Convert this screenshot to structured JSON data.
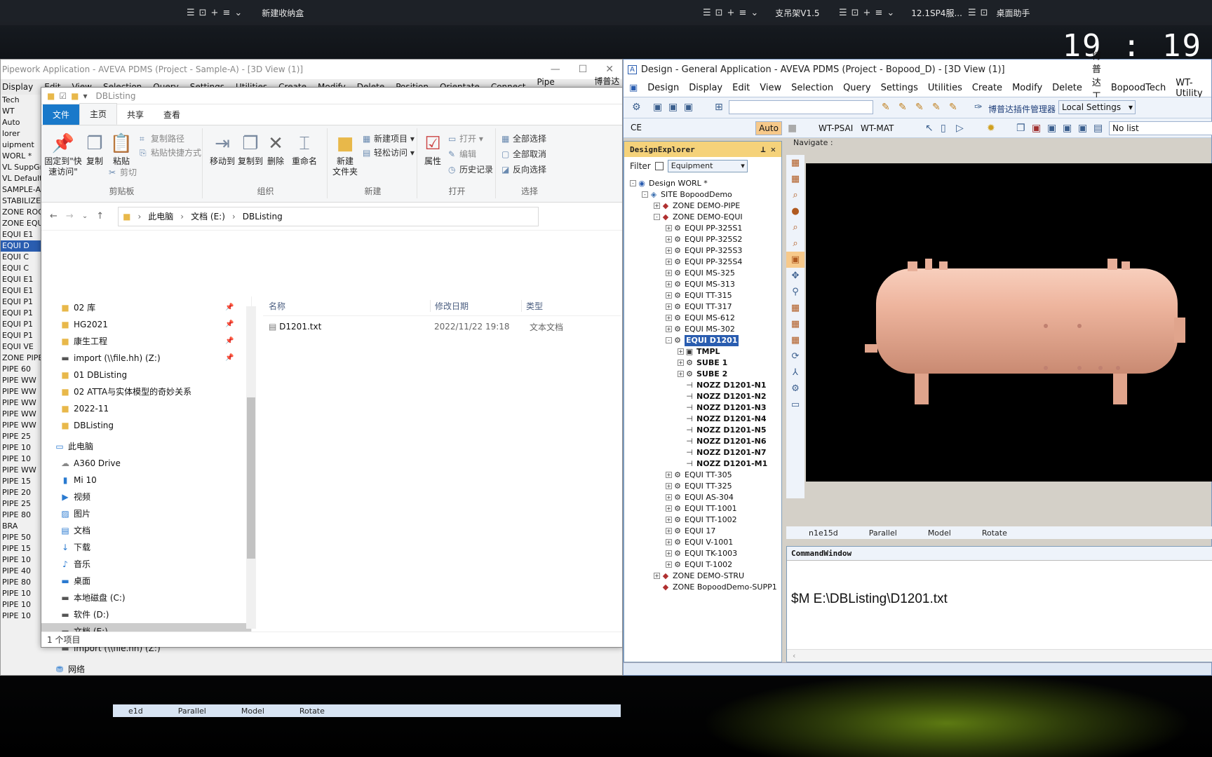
{
  "taskbar": {
    "groups": [
      {
        "label": "新建收纳盒"
      },
      {
        "label": "支吊架V1.5"
      },
      {
        "label": "12.1SP4服..."
      },
      {
        "label": "桌面助手"
      }
    ],
    "clock": "19 : 19"
  },
  "pipework": {
    "title": "Pipework Application -  AVEVA PDMS (Project - Sample-A) - [3D View (1)]",
    "menu": [
      "Display",
      "Edit",
      "View",
      "Selection",
      "Query",
      "Settings",
      "Utilities",
      "Create",
      "Modify",
      "Delete",
      "Position",
      "Orientate",
      "Connect",
      "Pipe Fabrication",
      "博普达工具集"
    ],
    "side_fragments": [
      "Tech",
      "WT",
      "Auto",
      "lorer",
      "uipment",
      "WORL *",
      "VL SuppGro",
      "VL Default_I",
      "SAMPLE-A",
      "STABILIZE",
      "ZONE ROO",
      "ZONE EQUI",
      "EQUI E1",
      "EQUI D",
      "EQUI C",
      "EQUI C",
      "EQUI E1",
      "EQUI E1",
      "EQUI P1",
      "EQUI P1",
      "EQUI P1",
      "EQUI P1",
      "EQUI VE",
      "ZONE PIPES",
      "PIPE 60",
      "PIPE WW",
      "PIPE WW",
      "PIPE WW",
      "PIPE WW",
      "PIPE WW",
      "PIPE 25",
      "PIPE 10",
      "PIPE 10",
      "PIPE WW",
      "PIPE 15",
      "PIPE 20",
      "PIPE 25",
      "PIPE 80",
      "BRA",
      "PIPE 50",
      "PIPE 15",
      "PIPE 10",
      "PIPE 40",
      "PIPE 80",
      "PIPE 10",
      "PIPE 10",
      "PIPE 10"
    ],
    "status": [
      "e1d",
      "Parallel",
      "Model",
      "Rotate"
    ]
  },
  "explorer": {
    "title": "DBListing",
    "tabs": [
      "文件",
      "主页",
      "共享",
      "查看"
    ],
    "ribbon": {
      "pin": "固定到\"快速访问\"",
      "copy": "复制",
      "paste": "粘贴",
      "copy_path": "复制路径",
      "paste_shortcut": "粘贴快捷方式",
      "cut": "剪切",
      "clipboard_group": "剪贴板",
      "move_to": "移动到",
      "copy_to": "复制到",
      "delete": "删除",
      "rename": "重命名",
      "organize_group": "组织",
      "new_folder": "新建\n文件夹",
      "new_item": "新建项目",
      "easy_access": "轻松访问",
      "new_group": "新建",
      "properties": "属性",
      "open": "打开",
      "edit": "编辑",
      "history": "历史记录",
      "open_group": "打开",
      "select_all": "全部选择",
      "select_none": "全部取消",
      "invert": "反向选择",
      "select_group": "选择"
    },
    "address": [
      "此电脑",
      "文档 (E:)",
      "DBListing"
    ],
    "nav": [
      {
        "label": "02 库",
        "icon": "folder",
        "pinned": true
      },
      {
        "label": "HG2021",
        "icon": "folder",
        "pinned": true
      },
      {
        "label": "康生工程",
        "icon": "folder",
        "pinned": true
      },
      {
        "label": "import (\\\\file.hh) (Z:)",
        "icon": "net",
        "pinned": true
      },
      {
        "label": "01 DBListing",
        "icon": "folder",
        "pinned": false
      },
      {
        "label": "02 ATTA与实体模型的奇妙关系",
        "icon": "folder",
        "pinned": false
      },
      {
        "label": "2022-11",
        "icon": "folder",
        "pinned": false
      },
      {
        "label": "DBListing",
        "icon": "folder",
        "pinned": false
      },
      {
        "label": "此电脑",
        "icon": "pc",
        "pinned": false,
        "top": true
      },
      {
        "label": "A360 Drive",
        "icon": "cloud",
        "pinned": false
      },
      {
        "label": "Mi 10",
        "icon": "phone",
        "pinned": false
      },
      {
        "label": "视频",
        "icon": "video",
        "pinned": false
      },
      {
        "label": "图片",
        "icon": "pic",
        "pinned": false
      },
      {
        "label": "文档",
        "icon": "doc",
        "pinned": false
      },
      {
        "label": "下载",
        "icon": "down",
        "pinned": false
      },
      {
        "label": "音乐",
        "icon": "music",
        "pinned": false
      },
      {
        "label": "桌面",
        "icon": "desk",
        "pinned": false
      },
      {
        "label": "本地磁盘 (C:)",
        "icon": "drive",
        "pinned": false
      },
      {
        "label": "软件 (D:)",
        "icon": "drive",
        "pinned": false
      },
      {
        "label": "文档 (E:)",
        "icon": "drive",
        "pinned": false,
        "selected": true
      },
      {
        "label": "import (\\\\file.hh) (Z:)",
        "icon": "net",
        "pinned": false
      },
      {
        "label": "网络",
        "icon": "network",
        "pinned": false,
        "top": true
      }
    ],
    "columns": [
      "名称",
      "修改日期",
      "类型"
    ],
    "files": [
      {
        "name": "D1201.txt",
        "modified": "2022/11/22 19:18",
        "type": "文本文档"
      }
    ],
    "status": "1 个项目"
  },
  "design": {
    "title": "Design - General Application -  AVEVA PDMS (Project - Bopood_D) - [3D View (1)]",
    "menu": [
      "Design",
      "Display",
      "Edit",
      "View",
      "Selection",
      "Query",
      "Settings",
      "Utilities",
      "Create",
      "Modify",
      "Delete",
      "博普达工具集",
      "BopoodTech",
      "WT-Utility",
      "W"
    ],
    "plugin_manager": "博普达插件管理器",
    "local_settings": "Local Settings",
    "ce": "CE",
    "auto": "Auto",
    "wt_psai": "WT-PSAI",
    "wt_mat": "WT-MAT",
    "no_list": "No list",
    "explorer_title": "DesignExplorer",
    "filter_label": "Filter",
    "filter_value": "Equipment",
    "navigate": "Navigate :",
    "tree": [
      {
        "label": "Design WORL *",
        "level": 0,
        "icon": "globe",
        "expander": "-"
      },
      {
        "label": "SITE BopoodDemo",
        "level": 1,
        "icon": "site",
        "expander": "-"
      },
      {
        "label": "ZONE DEMO-PIPE",
        "level": 2,
        "icon": "zone",
        "expander": "+"
      },
      {
        "label": "ZONE DEMO-EQUI",
        "level": 2,
        "icon": "zone",
        "expander": "-"
      },
      {
        "label": "EQUI PP-325S1",
        "level": 3,
        "icon": "equi",
        "expander": "+"
      },
      {
        "label": "EQUI PP-325S2",
        "level": 3,
        "icon": "equi",
        "expander": "+"
      },
      {
        "label": "EQUI PP-325S3",
        "level": 3,
        "icon": "equi",
        "expander": "+"
      },
      {
        "label": "EQUI PP-325S4",
        "level": 3,
        "icon": "equi",
        "expander": "+"
      },
      {
        "label": "EQUI MS-325",
        "level": 3,
        "icon": "equi",
        "expander": "+"
      },
      {
        "label": "EQUI MS-313",
        "level": 3,
        "icon": "equi",
        "expander": "+"
      },
      {
        "label": "EQUI TT-315",
        "level": 3,
        "icon": "equi",
        "expander": "+"
      },
      {
        "label": "EQUI TT-317",
        "level": 3,
        "icon": "equi",
        "expander": "+"
      },
      {
        "label": "EQUI MS-612",
        "level": 3,
        "icon": "equi",
        "expander": "+"
      },
      {
        "label": "EQUI MS-302",
        "level": 3,
        "icon": "equi",
        "expander": "+"
      },
      {
        "label": "EQUI D1201",
        "level": 3,
        "icon": "equi",
        "expander": "-",
        "selected": true
      },
      {
        "label": "TMPL",
        "level": 4,
        "icon": "tmpl",
        "expander": "+",
        "bold": true
      },
      {
        "label": "SUBE 1",
        "level": 4,
        "icon": "sube",
        "expander": "+",
        "bold": true
      },
      {
        "label": "SUBE 2",
        "level": 4,
        "icon": "sube",
        "expander": "+",
        "bold": true
      },
      {
        "label": "NOZZ D1201-N1",
        "level": 4,
        "icon": "nozz",
        "bold": true
      },
      {
        "label": "NOZZ D1201-N2",
        "level": 4,
        "icon": "nozz",
        "bold": true
      },
      {
        "label": "NOZZ D1201-N3",
        "level": 4,
        "icon": "nozz",
        "bold": true
      },
      {
        "label": "NOZZ D1201-N4",
        "level": 4,
        "icon": "nozz",
        "bold": true
      },
      {
        "label": "NOZZ D1201-N5",
        "level": 4,
        "icon": "nozz",
        "bold": true
      },
      {
        "label": "NOZZ D1201-N6",
        "level": 4,
        "icon": "nozz",
        "bold": true
      },
      {
        "label": "NOZZ D1201-N7",
        "level": 4,
        "icon": "nozz",
        "bold": true
      },
      {
        "label": "NOZZ D1201-M1",
        "level": 4,
        "icon": "nozz",
        "bold": true
      },
      {
        "label": "EQUI TT-305",
        "level": 3,
        "icon": "equi",
        "expander": "+"
      },
      {
        "label": "EQUI TT-325",
        "level": 3,
        "icon": "equi",
        "expander": "+"
      },
      {
        "label": "EQUI AS-304",
        "level": 3,
        "icon": "equi",
        "expander": "+"
      },
      {
        "label": "EQUI TT-1001",
        "level": 3,
        "icon": "equi",
        "expander": "+"
      },
      {
        "label": "EQUI TT-1002",
        "level": 3,
        "icon": "equi",
        "expander": "+"
      },
      {
        "label": "EQUI 17",
        "level": 3,
        "icon": "equi",
        "expander": "+"
      },
      {
        "label": "EQUI V-1001",
        "level": 3,
        "icon": "equi",
        "expander": "+"
      },
      {
        "label": "EQUI TK-1003",
        "level": 3,
        "icon": "equi",
        "expander": "+"
      },
      {
        "label": "EQUI T-1002",
        "level": 3,
        "icon": "equi",
        "expander": "+"
      },
      {
        "label": "ZONE DEMO-STRU",
        "level": 2,
        "icon": "zone",
        "expander": "+"
      },
      {
        "label": "ZONE BopoodDemo-SUPP1",
        "level": 2,
        "icon": "zone"
      }
    ],
    "view_status": [
      "n1e15d",
      "Parallel",
      "Model",
      "Rotate"
    ],
    "command_title": "CommandWindow",
    "command_text": "$M E:\\DBListing\\D1201.txt",
    "vessel_color": "#e8a58e"
  }
}
